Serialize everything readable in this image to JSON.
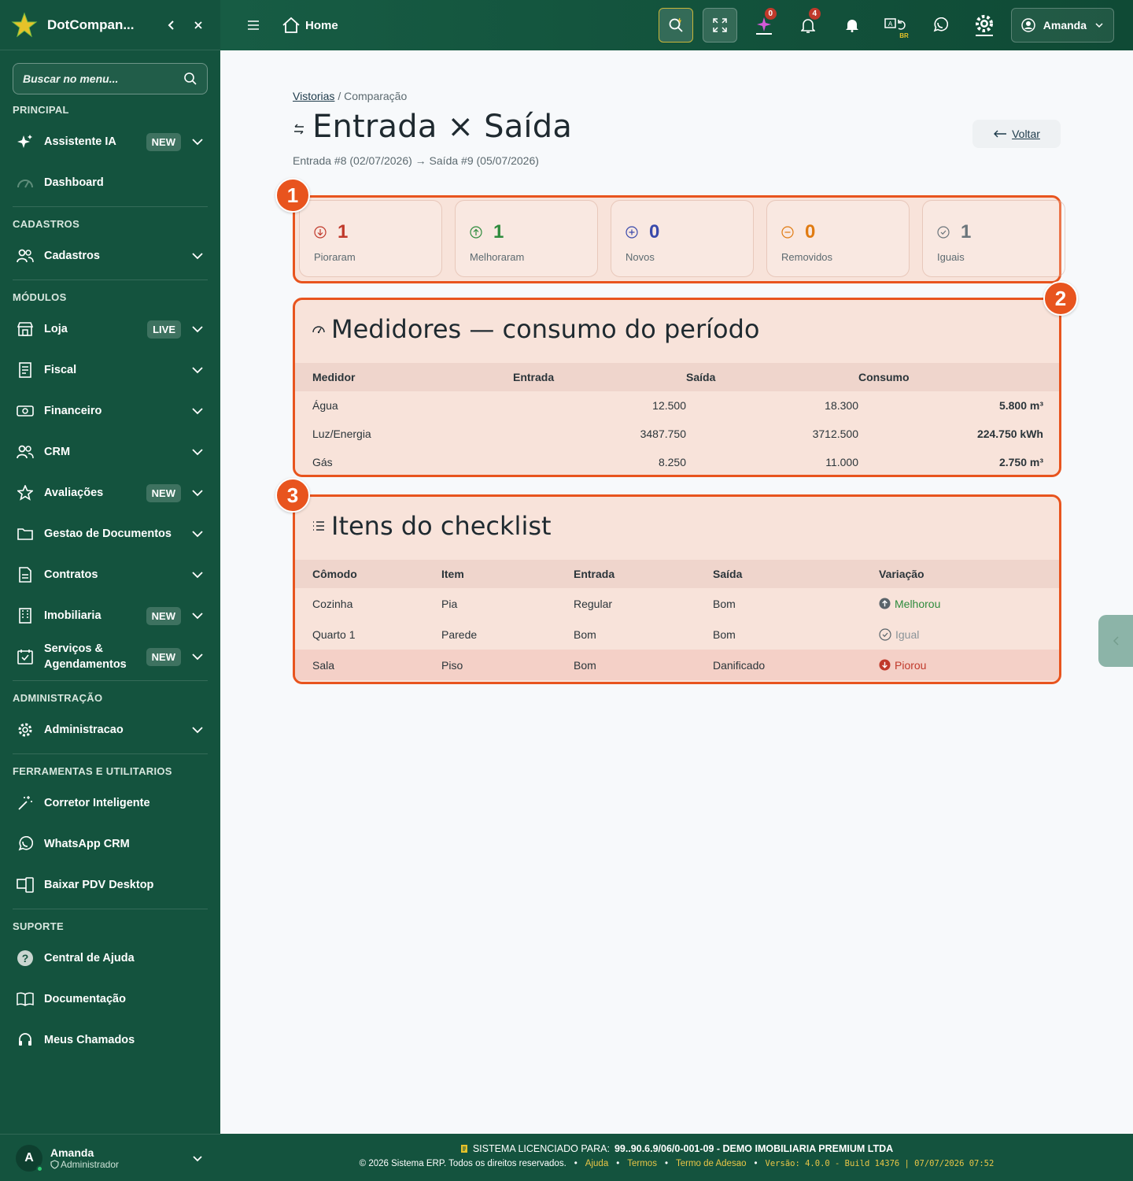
{
  "sidebar": {
    "brand": "DotCompan...",
    "search_placeholder": "Buscar no menu...",
    "sections": {
      "principal": "PRINCIPAL",
      "cadastros": "CADASTROS",
      "modulos": "MÓDULOS",
      "administracao": "ADMINISTRAÇÃO",
      "ferramentas": "FERRAMENTAS E UTILITARIOS",
      "suporte": "SUPORTE"
    },
    "items": {
      "assistente": {
        "label": "Assistente IA",
        "badge": "NEW"
      },
      "dashboard": {
        "label": "Dashboard"
      },
      "cadastros": {
        "label": "Cadastros"
      },
      "loja": {
        "label": "Loja",
        "badge": "LIVE"
      },
      "fiscal": {
        "label": "Fiscal"
      },
      "financeiro": {
        "label": "Financeiro"
      },
      "crm": {
        "label": "CRM"
      },
      "avaliacoes": {
        "label": "Avaliações",
        "badge": "NEW"
      },
      "documentos": {
        "label": "Gestao de Documentos"
      },
      "contratos": {
        "label": "Contratos"
      },
      "imobiliaria": {
        "label": "Imobiliaria",
        "badge": "NEW"
      },
      "servicos": {
        "label": "Serviços & Agendamentos",
        "badge": "NEW"
      },
      "administracao": {
        "label": "Administracao"
      },
      "corretor": {
        "label": "Corretor Inteligente"
      },
      "whatsapp": {
        "label": "WhatsApp CRM"
      },
      "pdv": {
        "label": "Baixar PDV Desktop"
      },
      "ajuda": {
        "label": "Central de Ajuda"
      },
      "documentacao": {
        "label": "Documentação"
      },
      "chamados": {
        "label": "Meus Chamados"
      }
    },
    "user": {
      "name": "Amanda",
      "role": "Administrador",
      "initial": "A"
    }
  },
  "topbar": {
    "home_label": "Home",
    "ai_count": "0",
    "notif_count": "4",
    "lang_badge": "BR",
    "user_label": "Amanda"
  },
  "page": {
    "breadcrumb_link": "Vistorias",
    "breadcrumb_current": "/ Comparação",
    "title": "Entrada × Saída",
    "subtitle": "Entrada #8 (02/07/2026) → Saída #9 (05/07/2026)",
    "back_label": "Voltar"
  },
  "markers": [
    "1",
    "2",
    "3"
  ],
  "stats": [
    {
      "value": "1",
      "label": "Pioraram",
      "color": "#c0392b",
      "icon": "arrow-down-circle-icon"
    },
    {
      "value": "1",
      "label": "Melhoraram",
      "color": "#2e8b3d",
      "icon": "arrow-up-circle-icon"
    },
    {
      "value": "0",
      "label": "Novos",
      "color": "#3949ab",
      "icon": "plus-circle-icon"
    },
    {
      "value": "0",
      "label": "Removidos",
      "color": "#e07b12",
      "icon": "minus-circle-icon"
    },
    {
      "value": "1",
      "label": "Iguais",
      "color": "#6b757b",
      "icon": "check-circle-icon"
    }
  ],
  "meters": {
    "title": "Medidores — consumo do período",
    "headers": [
      "Medidor",
      "Entrada",
      "Saída",
      "Consumo"
    ],
    "rows": [
      {
        "name": "Água",
        "entrada": "12.500",
        "saida": "18.300",
        "consumo": "5.800 m³"
      },
      {
        "name": "Luz/Energia",
        "entrada": "3487.750",
        "saida": "3712.500",
        "consumo": "224.750 kWh"
      },
      {
        "name": "Gás",
        "entrada": "8.250",
        "saida": "11.000",
        "consumo": "2.750 m³"
      }
    ]
  },
  "checklist": {
    "title": "Itens do checklist",
    "headers": [
      "Cômodo",
      "Item",
      "Entrada",
      "Saída",
      "Variação"
    ],
    "rows": [
      {
        "comodo": "Cozinha",
        "item": "Pia",
        "entrada": "Regular",
        "saida": "Bom",
        "variacao": "Melhorou",
        "color": "#2e8b3d"
      },
      {
        "comodo": "Quarto 1",
        "item": "Parede",
        "entrada": "Bom",
        "saida": "Bom",
        "variacao": "Igual",
        "color": "#8a9499"
      },
      {
        "comodo": "Sala",
        "item": "Piso",
        "entrada": "Bom",
        "saida": "Danificado",
        "variacao": "Piorou",
        "color": "#c0392b"
      }
    ]
  },
  "footer": {
    "license_prefix": "SISTEMA LICENCIADO PARA:",
    "license_holder": "99..90.6.9/06/0-001-09 - DEMO IMOBILIARIA PREMIUM LTDA",
    "copyright": "© 2026 Sistema ERP. Todos os direitos reservados.",
    "links": [
      "Ajuda",
      "Termos",
      "Termo de Adesao"
    ],
    "version": "Versão: 4.0.0 - Build 14376 | 07/07/2026 07:52"
  }
}
